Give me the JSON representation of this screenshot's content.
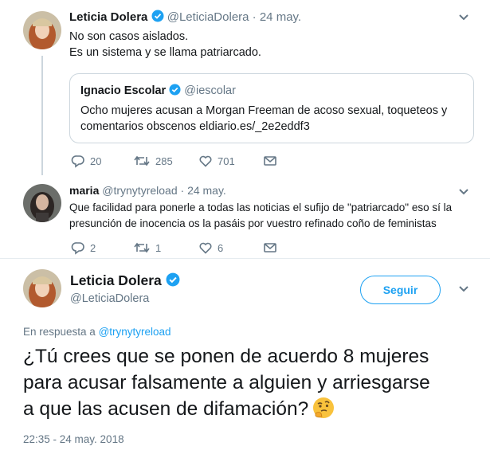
{
  "tweet1": {
    "name": "Leticia Dolera",
    "handle": "@LeticiaDolera",
    "separator": "·",
    "date": "24 may.",
    "text_line1": "No son casos aislados.",
    "text_line2": "Es un sistema y se llama patriarcado.",
    "quote": {
      "name": "Ignacio Escolar",
      "handle": "@iescolar",
      "text_line1": "Ocho mujeres acusan a Morgan Freeman de acoso sexual, toqueteos y",
      "text_line2": "comentarios obscenos eldiario.es/_2e2eddf3"
    },
    "actions": {
      "replies": "20",
      "retweets": "285",
      "likes": "701"
    }
  },
  "tweet2": {
    "name": "maria",
    "handle": "@trynytyreload",
    "separator": "·",
    "date": "24 may.",
    "text_line1": "Que facilidad para ponerle a todas las noticias el sufijo de \"patriarcado\" eso sí la",
    "text_line2": "presunción de inocencia os la pasáis por vuestro refinado coño de feministas",
    "actions": {
      "replies": "2",
      "retweets": "1",
      "likes": "6"
    }
  },
  "main_tweet": {
    "name": "Leticia Dolera",
    "handle": "@LeticiaDolera",
    "follow_label": "Seguir",
    "reply_prefix": "En respuesta a",
    "reply_mention": "@trynytyreload",
    "text_line1": "¿Tú crees que se ponen de acuerdo 8 mujeres",
    "text_line2": "para acusar falsamente a alguien y arriesgarse",
    "text_line3": "a que las acusen de difamación?",
    "emoji": "thinking-face-icon",
    "timestamp": "22:35 - 24 may. 2018"
  },
  "colors": {
    "accent": "#1da1f2",
    "secondary_text": "#657786",
    "border": "#ccd6dd"
  }
}
